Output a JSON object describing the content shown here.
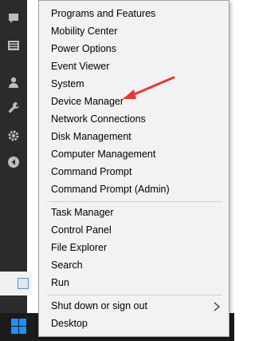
{
  "menu": {
    "group1": [
      "Programs and Features",
      "Mobility Center",
      "Power Options",
      "Event Viewer",
      "System",
      "Device Manager",
      "Network Connections",
      "Disk Management",
      "Computer Management",
      "Command Prompt",
      "Command Prompt (Admin)"
    ],
    "group2": [
      "Task Manager",
      "Control Panel",
      "File Explorer",
      "Search",
      "Run"
    ],
    "group3": [
      "Shut down or sign out",
      "Desktop"
    ]
  },
  "sidebar_icons": [
    "chat-icon",
    "list-icon",
    "user-icon",
    "wrench-icon",
    "gear-icon",
    "back-icon"
  ],
  "colors": {
    "sidebar": "#2b2b2b",
    "menu_bg": "#f2f2f2",
    "annotation_arrow": "#e53935",
    "start_logo": "#1e90ff"
  }
}
